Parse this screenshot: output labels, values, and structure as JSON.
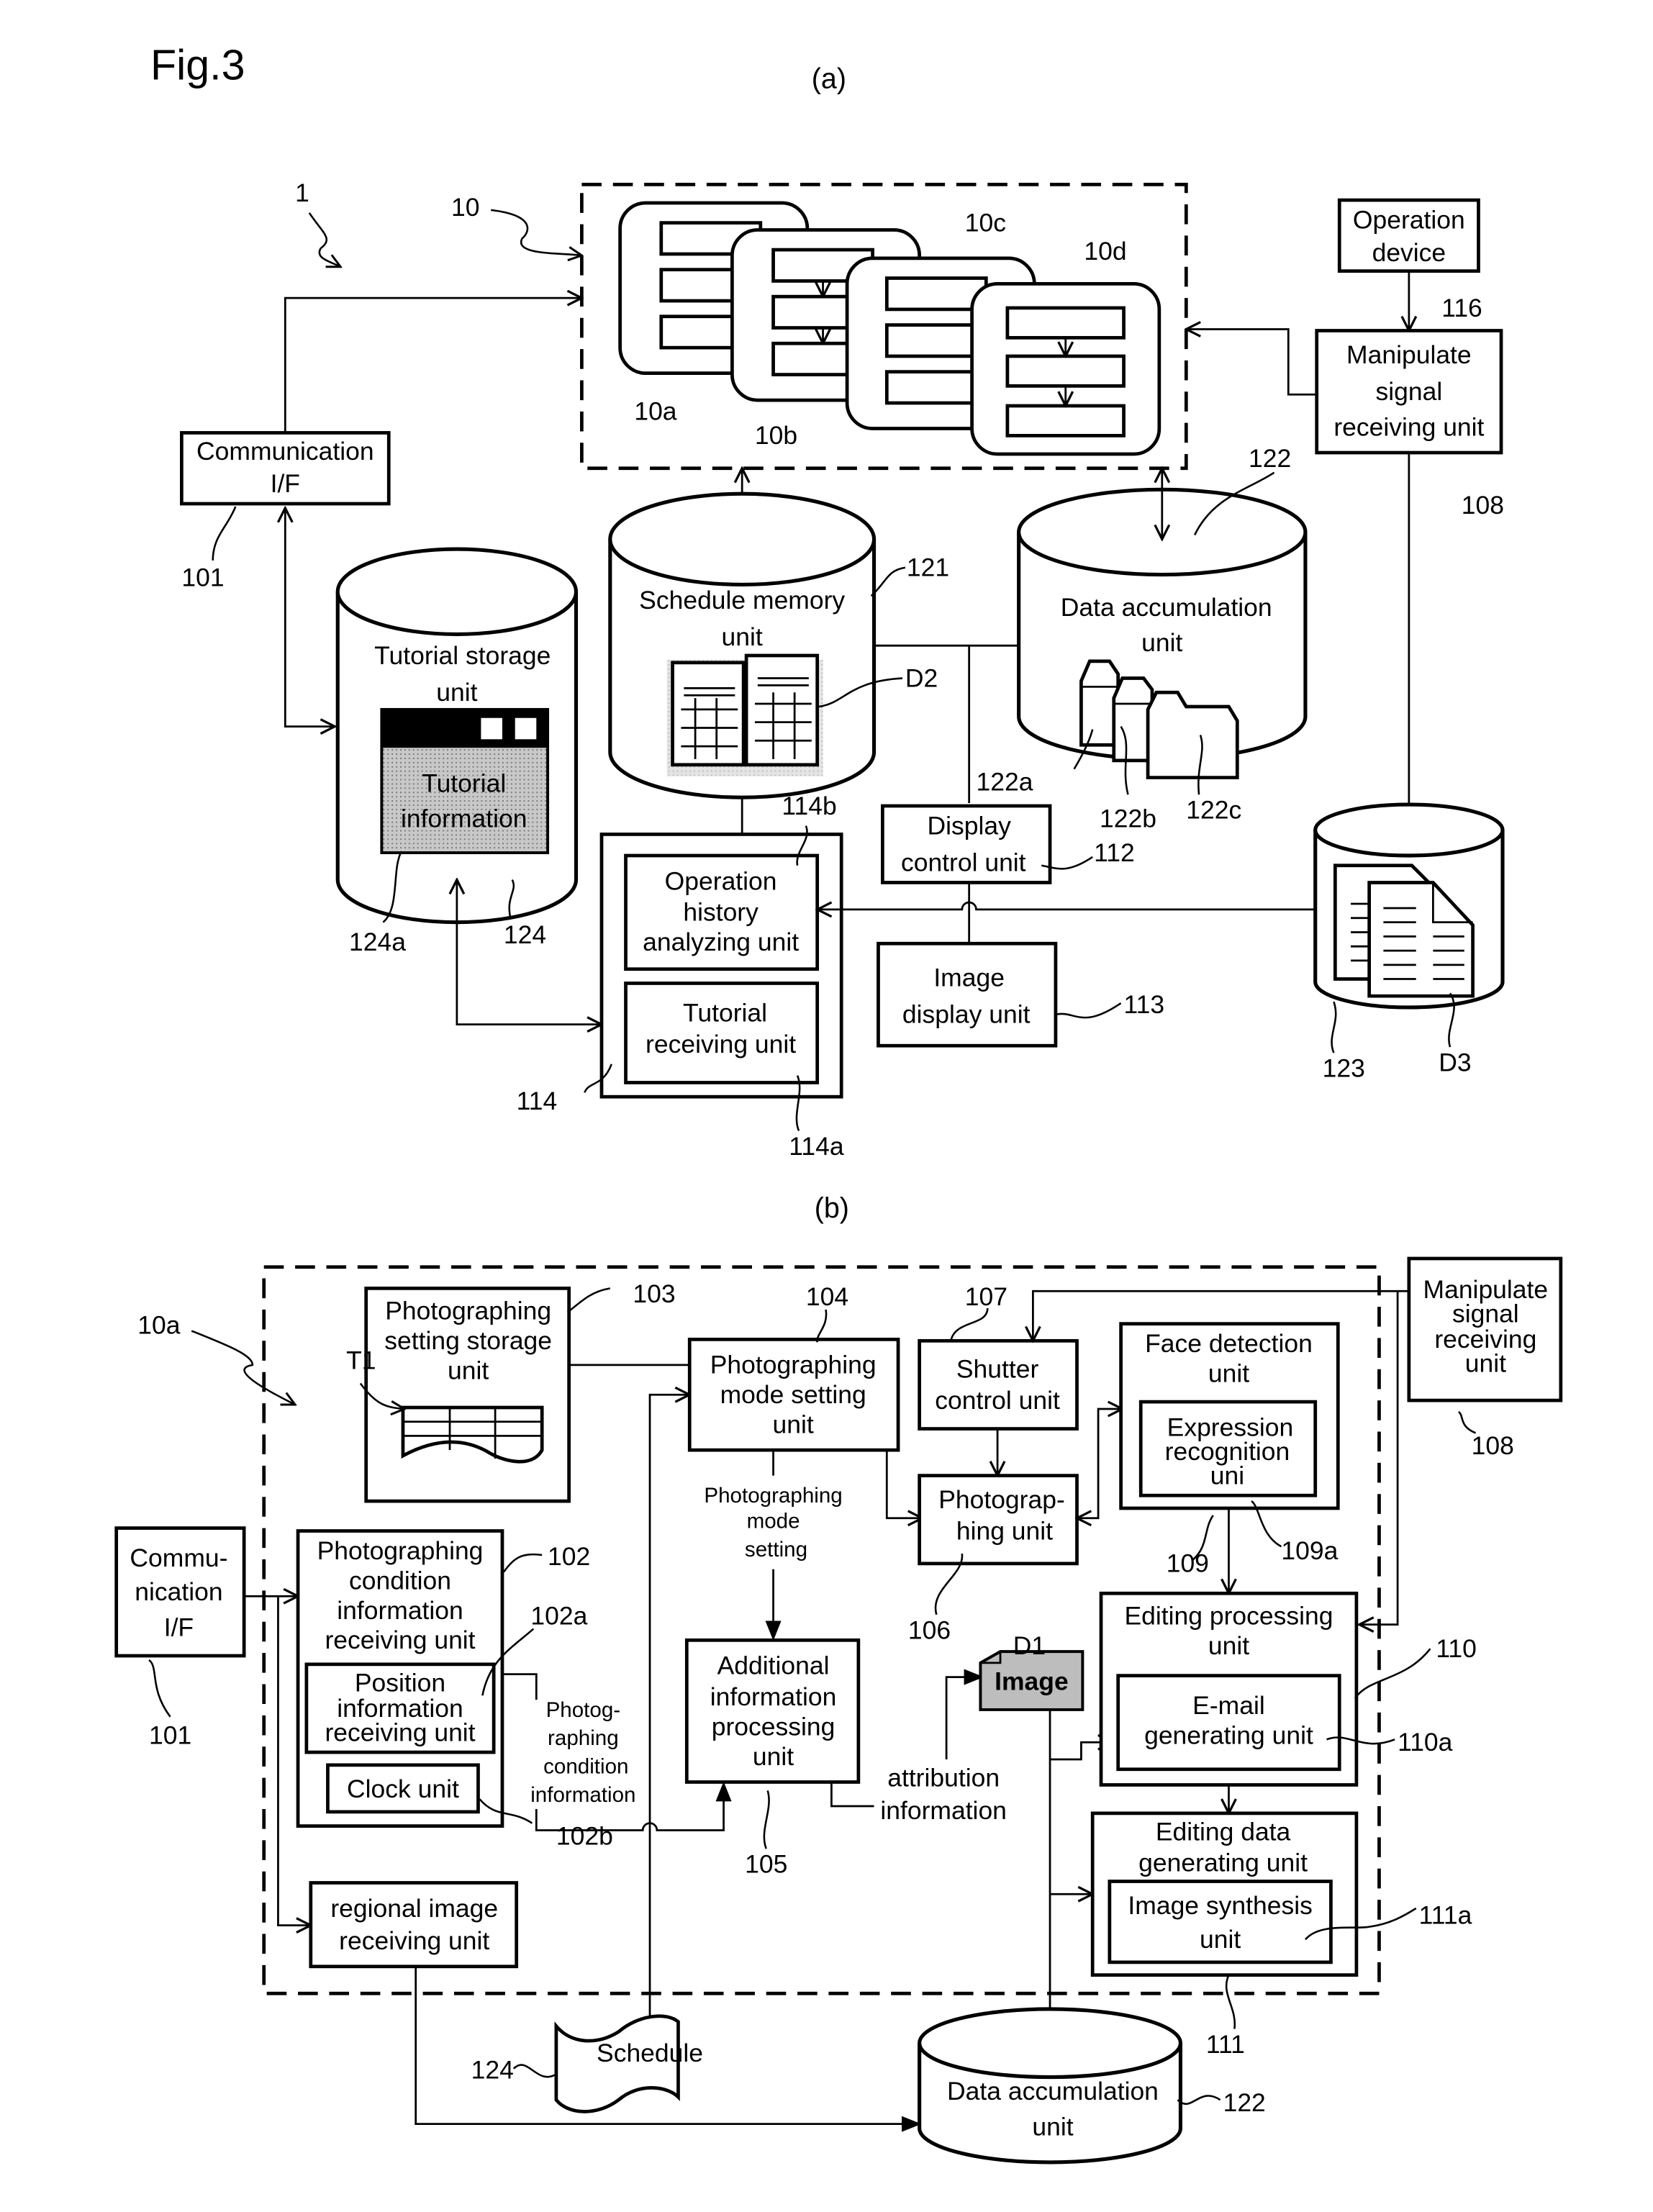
{
  "figure": {
    "title": "Fig.3",
    "part_a_label": "(a)",
    "part_b_label": "(b)"
  },
  "part_a": {
    "system_ref": "1",
    "terminal_group_ref": "10",
    "terminal_refs": [
      "10a",
      "10b",
      "10c",
      "10d"
    ],
    "communication_if": {
      "label_lines": [
        "Communication",
        "I/F"
      ],
      "ref": "101"
    },
    "operation_device": {
      "label_lines": [
        "Operation",
        "device"
      ],
      "ref": "116"
    },
    "manipulate_signal_unit": {
      "label_lines": [
        "Manipulate",
        "signal",
        "receiving unit"
      ],
      "ref": "108"
    },
    "schedule_memory_unit": {
      "label_lines": [
        "Schedule memory",
        "unit"
      ],
      "ref": "121",
      "data_ref": "D2"
    },
    "data_accumulation_unit": {
      "label_lines": [
        "Data accumulation",
        "unit"
      ],
      "ref": "122",
      "folder_refs": [
        "122a",
        "122b",
        "122c"
      ]
    },
    "tutorial_storage_unit": {
      "label_lines": [
        "Tutorial storage",
        "unit"
      ],
      "ref": "124",
      "info_lines": [
        "Tutorial",
        "information"
      ],
      "info_ref": "124a"
    },
    "display_control_unit": {
      "label_lines": [
        "Display",
        "control unit"
      ],
      "ref": "112"
    },
    "image_display_unit": {
      "label_lines": [
        "Image",
        "display unit"
      ],
      "ref": "113"
    },
    "tutorial_unit": {
      "ref": "114",
      "operation_history": {
        "label_lines": [
          "Operation",
          "history",
          "analyzing unit"
        ],
        "ref": "114b"
      },
      "tutorial_receiving": {
        "label_lines": [
          "Tutorial",
          "receiving unit"
        ],
        "ref": "114a"
      }
    },
    "log_storage": {
      "ref": "123",
      "doc_ref": "D3"
    }
  },
  "part_b": {
    "terminal_ref": "10a",
    "communication_if": {
      "label_lines": [
        "Commu-",
        "nication",
        "I/F"
      ],
      "ref": "101"
    },
    "photographing_setting_storage": {
      "label_lines": [
        "Photographing",
        "setting storage",
        "unit"
      ],
      "ref": "103",
      "table_ref": "T1"
    },
    "photographing_mode_setting": {
      "label_lines": [
        "Photographing",
        "mode setting",
        "unit"
      ],
      "ref": "104"
    },
    "photographing_mode_setting_note": [
      "Photographing",
      "mode",
      "setting"
    ],
    "shutter_control": {
      "label_lines": [
        "Shutter",
        "control unit"
      ],
      "ref": "107"
    },
    "photographing_unit": {
      "label_lines": [
        "Photograp-",
        "hing unit"
      ],
      "ref": "106"
    },
    "face_detection": {
      "label_lines": [
        "Face detection",
        "unit"
      ],
      "ref": "109"
    },
    "expression_recognition": {
      "label_lines": [
        "Expression",
        "recognition",
        "uni"
      ],
      "ref": "109a"
    },
    "manipulate_signal_unit": {
      "label_lines": [
        "Manipulate",
        "signal",
        "receiving",
        "unit"
      ],
      "ref": "108"
    },
    "photographing_condition_receiving": {
      "label_lines": [
        "Photographing",
        "condition",
        "information",
        "receiving unit"
      ],
      "ref": "102"
    },
    "position_info_receiving": {
      "label_lines": [
        "Position",
        "information",
        "receiving unit"
      ],
      "ref": "102a"
    },
    "clock_unit": {
      "label": "Clock unit",
      "ref": "102b"
    },
    "condition_info_note": [
      "Photog-",
      "raphing",
      "condition",
      "information"
    ],
    "additional_info_processing": {
      "label_lines": [
        "Additional",
        "information",
        "processing",
        "unit"
      ],
      "ref": "105"
    },
    "attribution_info_note": [
      "attribution",
      "information"
    ],
    "image_data": {
      "label": "Image",
      "ref": "D1"
    },
    "editing_processing": {
      "label_lines": [
        "Editing processing",
        "unit"
      ],
      "ref": "110"
    },
    "email_generating": {
      "label_lines": [
        "E-mail",
        "generating unit"
      ],
      "ref": "110a"
    },
    "editing_data_generating": {
      "label_lines": [
        "Editing data",
        "generating unit"
      ],
      "ref": "111"
    },
    "image_synthesis": {
      "label_lines": [
        "Image synthesis",
        "unit"
      ],
      "ref": "111a"
    },
    "regional_image_receiving": {
      "label_lines": [
        "regional image",
        "receiving unit"
      ]
    },
    "schedule": {
      "label": "Schedule",
      "ref": "124"
    },
    "data_accumulation_unit": {
      "label_lines": [
        "Data accumulation",
        "unit"
      ],
      "ref": "122"
    }
  }
}
